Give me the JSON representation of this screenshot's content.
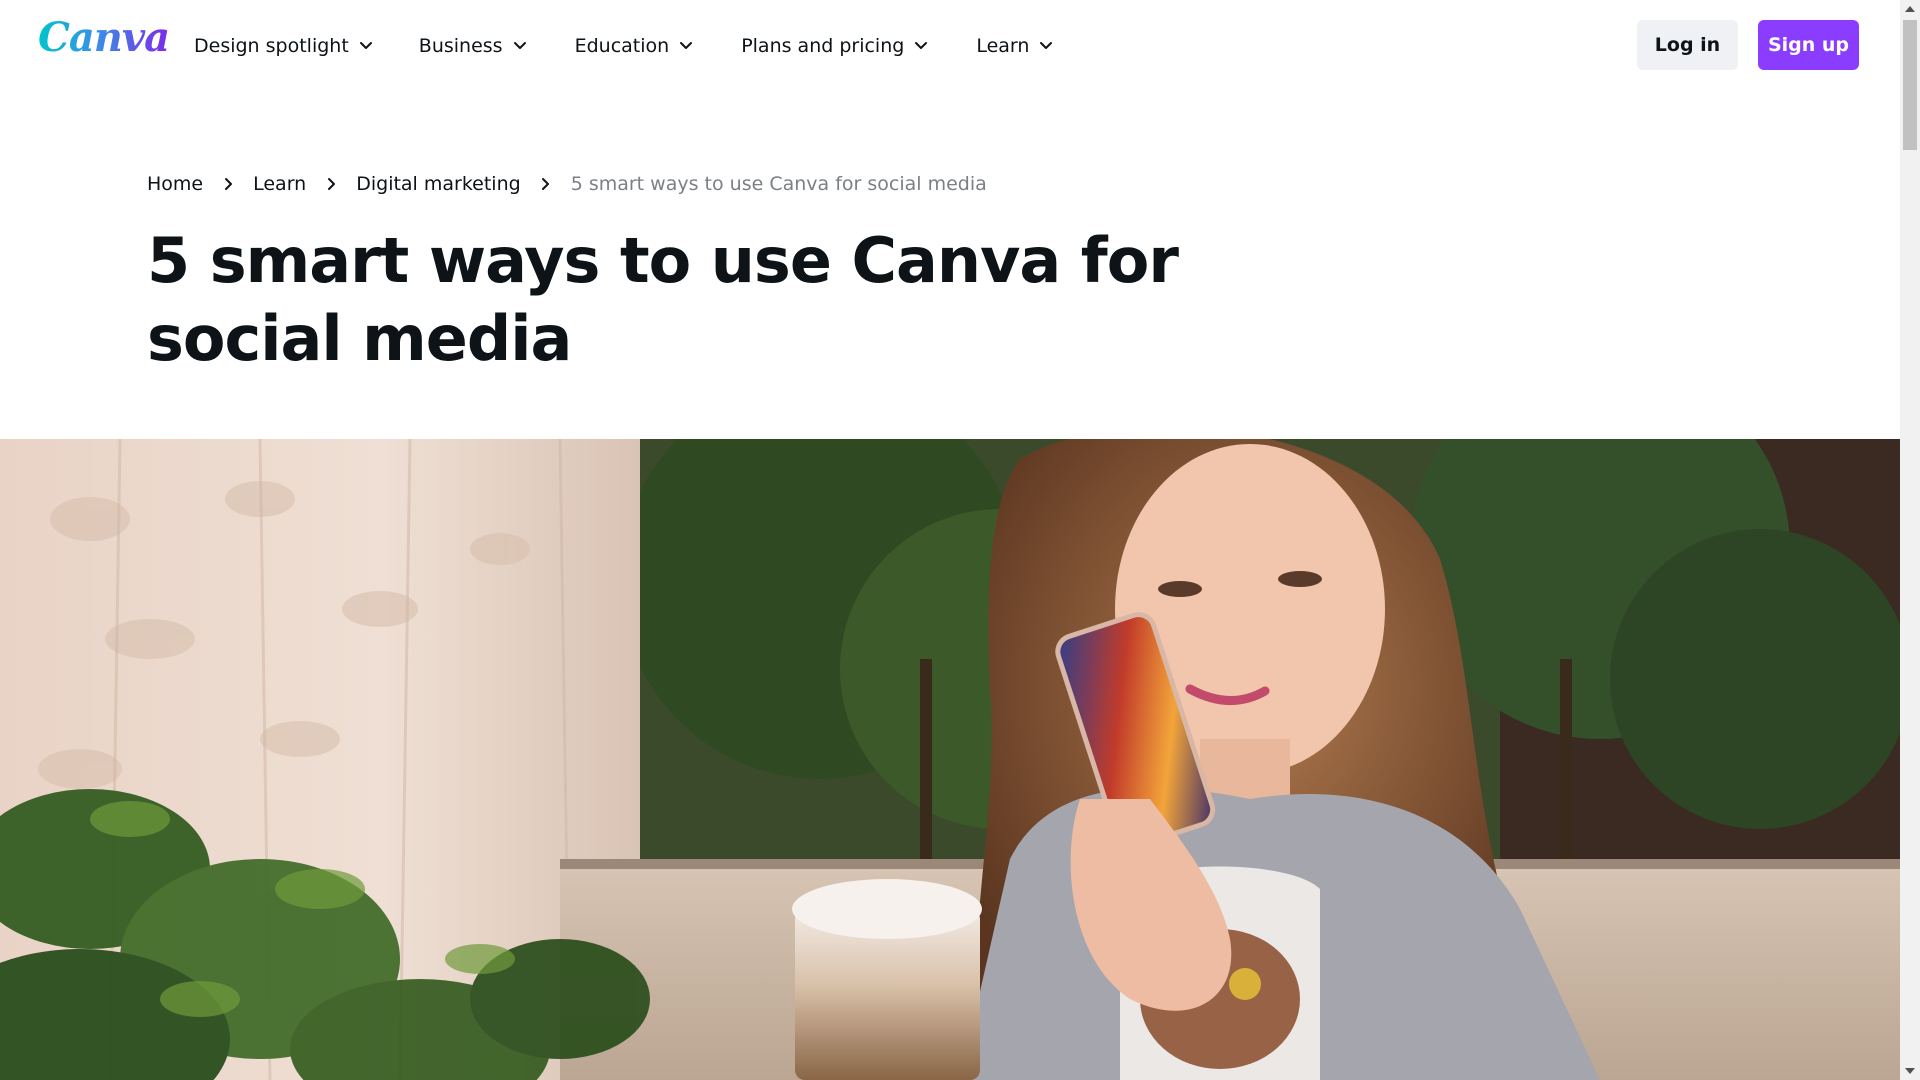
{
  "header": {
    "logo_text": "Canva",
    "nav": [
      {
        "label": "Design spotlight"
      },
      {
        "label": "Business"
      },
      {
        "label": "Education"
      },
      {
        "label": "Plans and pricing"
      },
      {
        "label": "Learn"
      }
    ],
    "login_label": "Log in",
    "signup_label": "Sign up"
  },
  "breadcrumb": {
    "items": [
      "Home",
      "Learn",
      "Digital marketing"
    ],
    "current": "5 smart ways to use Canva for social media"
  },
  "article": {
    "title": "5 smart ways to use Canva for social media"
  },
  "hero": {
    "alt": "woman-holding-phone-photo"
  },
  "colors": {
    "brand_purple": "#8b3dff",
    "text": "#0e1318",
    "muted": "#7b7f87",
    "login_bg": "#f0f1f5"
  },
  "icons": [
    "chevron-down-icon",
    "chevron-right-icon",
    "scroll-up-arrow-icon",
    "scroll-down-arrow-icon"
  ]
}
